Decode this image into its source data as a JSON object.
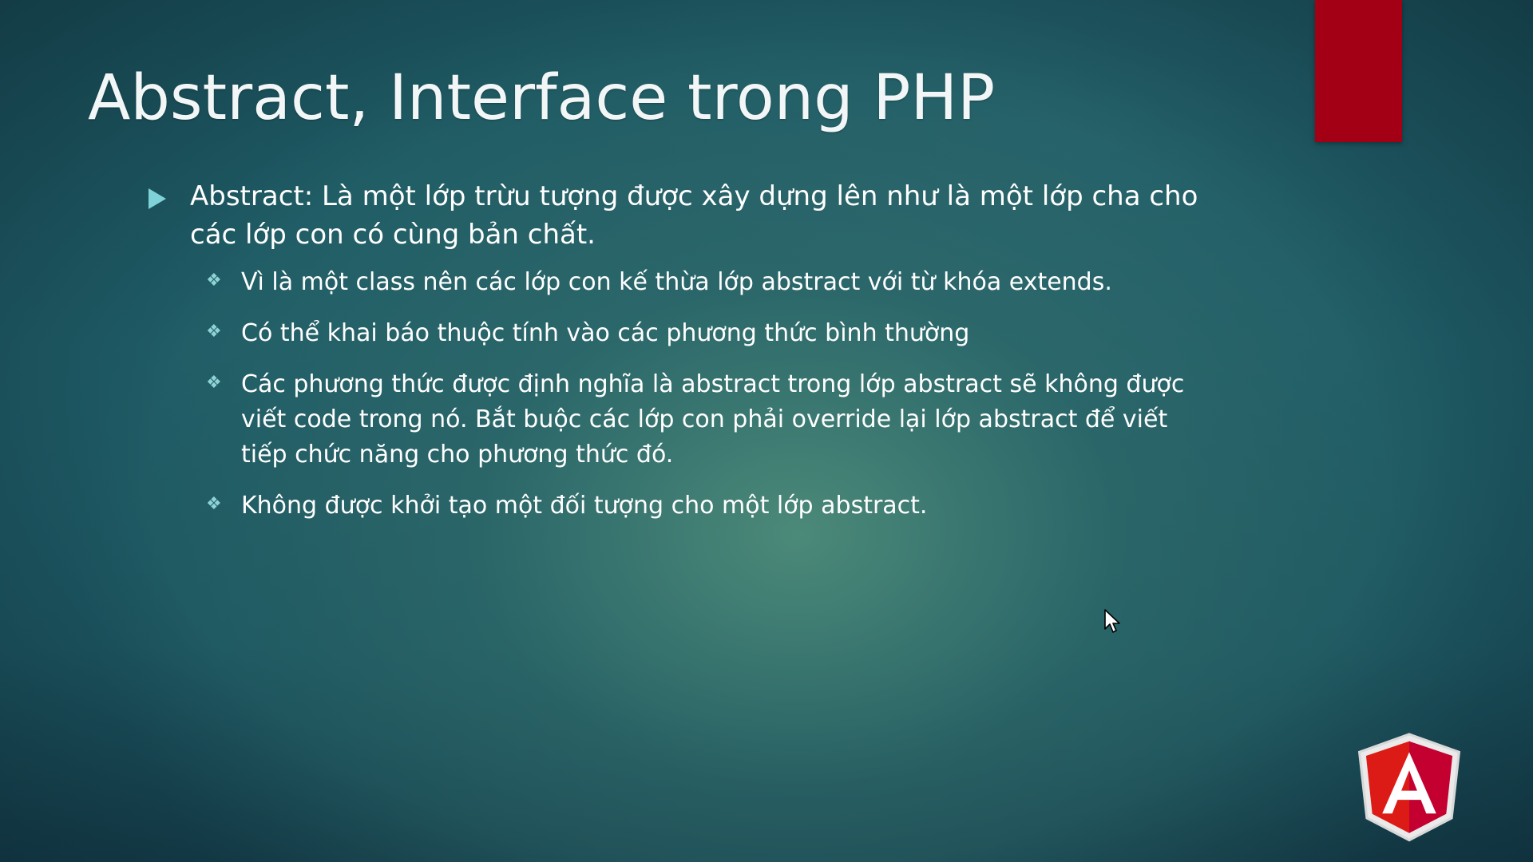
{
  "slide": {
    "title": "Abstract, Interface trong PHP",
    "bullet_main": "Abstract: Là một lớp trừu tượng được xây dựng lên như là một lớp cha cho các lớp con có cùng bản chất.",
    "sub_bullets": [
      "Vì là một class nên các lớp con kế thừa lớp abstract với từ khóa extends.",
      "Có thể khai báo thuộc tính vào các phương thức bình thường",
      "Các phương thức được định nghĩa là abstract trong lớp abstract sẽ không được viết code trong nó. Bắt buộc các lớp con phải override lại lớp abstract để viết tiếp chức năng cho phương thức đó.",
      "Không được khởi tạo một đối tượng cho  một lớp abstract."
    ],
    "sub_bullet_glyph": "❖"
  },
  "logo": {
    "letter": "A",
    "icon": "angular-logo-icon"
  },
  "colors": {
    "accent_bar": "#a30016",
    "bullet": "#7fd3d8",
    "logo_red": "#dd1b16",
    "logo_dark_red": "#c3002f"
  }
}
